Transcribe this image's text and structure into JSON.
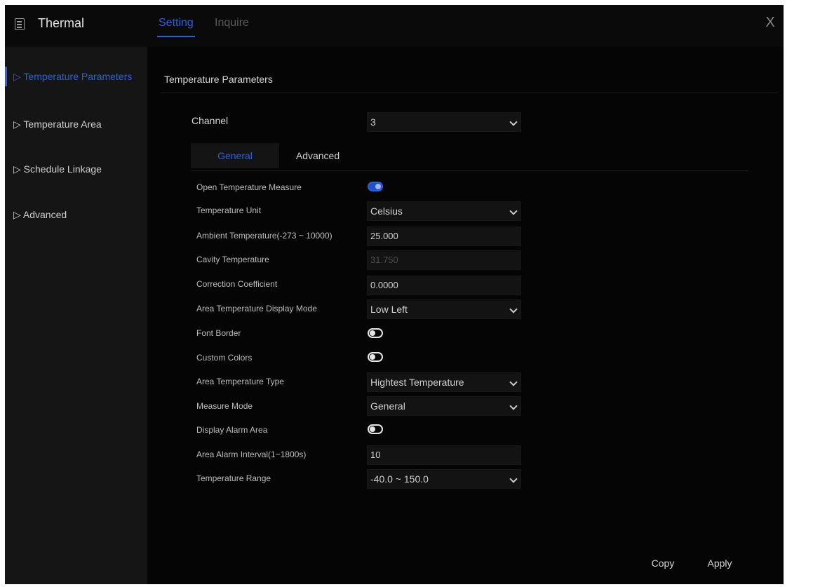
{
  "header": {
    "app_icon": "document-icon",
    "title": "Thermal",
    "tabs": [
      {
        "label": "Setting",
        "active": true
      },
      {
        "label": "Inquire",
        "active": false
      }
    ],
    "close_label": "X"
  },
  "sidebar": {
    "items": [
      {
        "label": "▷ Temperature Parameters",
        "active": true
      },
      {
        "label": "▷ Temperature Area",
        "active": false
      },
      {
        "label": "▷ Schedule Linkage",
        "active": false
      },
      {
        "label": "▷ Advanced",
        "active": false
      }
    ]
  },
  "main": {
    "section_title": "Temperature Parameters",
    "channel": {
      "label": "Channel",
      "value": "3"
    },
    "sub_tabs": [
      {
        "label": "General",
        "active": true
      },
      {
        "label": "Advanced",
        "active": false
      }
    ],
    "rows": {
      "open_temp_measure": {
        "label": "Open Temperature Measure",
        "on": true
      },
      "temp_unit": {
        "label": "Temperature Unit",
        "value": "Celsius"
      },
      "ambient_temp": {
        "label": "Ambient Temperature(-273 ~ 10000)",
        "value": "25.000"
      },
      "cavity_temp": {
        "label": "Cavity Temperature",
        "value": "31.750"
      },
      "correction_coeff": {
        "label": "Correction Coefficient",
        "value": "0.0000"
      },
      "area_display_mode": {
        "label": "Area Temperature Display Mode",
        "value": "Low Left"
      },
      "font_border": {
        "label": "Font Border",
        "on": false
      },
      "custom_colors": {
        "label": "Custom Colors",
        "on": false
      },
      "area_temp_type": {
        "label": "Area Temperature Type",
        "value": "Hightest Temperature"
      },
      "measure_mode": {
        "label": "Measure Mode",
        "value": "General"
      },
      "display_alarm_area": {
        "label": "Display Alarm Area",
        "on": false
      },
      "area_alarm_interval": {
        "label": "Area Alarm Interval(1~1800s)",
        "value": "10"
      },
      "temp_range": {
        "label": "Temperature Range",
        "value": "-40.0 ~ 150.0"
      }
    }
  },
  "footer": {
    "copy_label": "Copy",
    "apply_label": "Apply"
  },
  "colors": {
    "accent": "#2f5fd8",
    "background": "#050505",
    "sidebar": "#151515",
    "field": "#131313"
  }
}
